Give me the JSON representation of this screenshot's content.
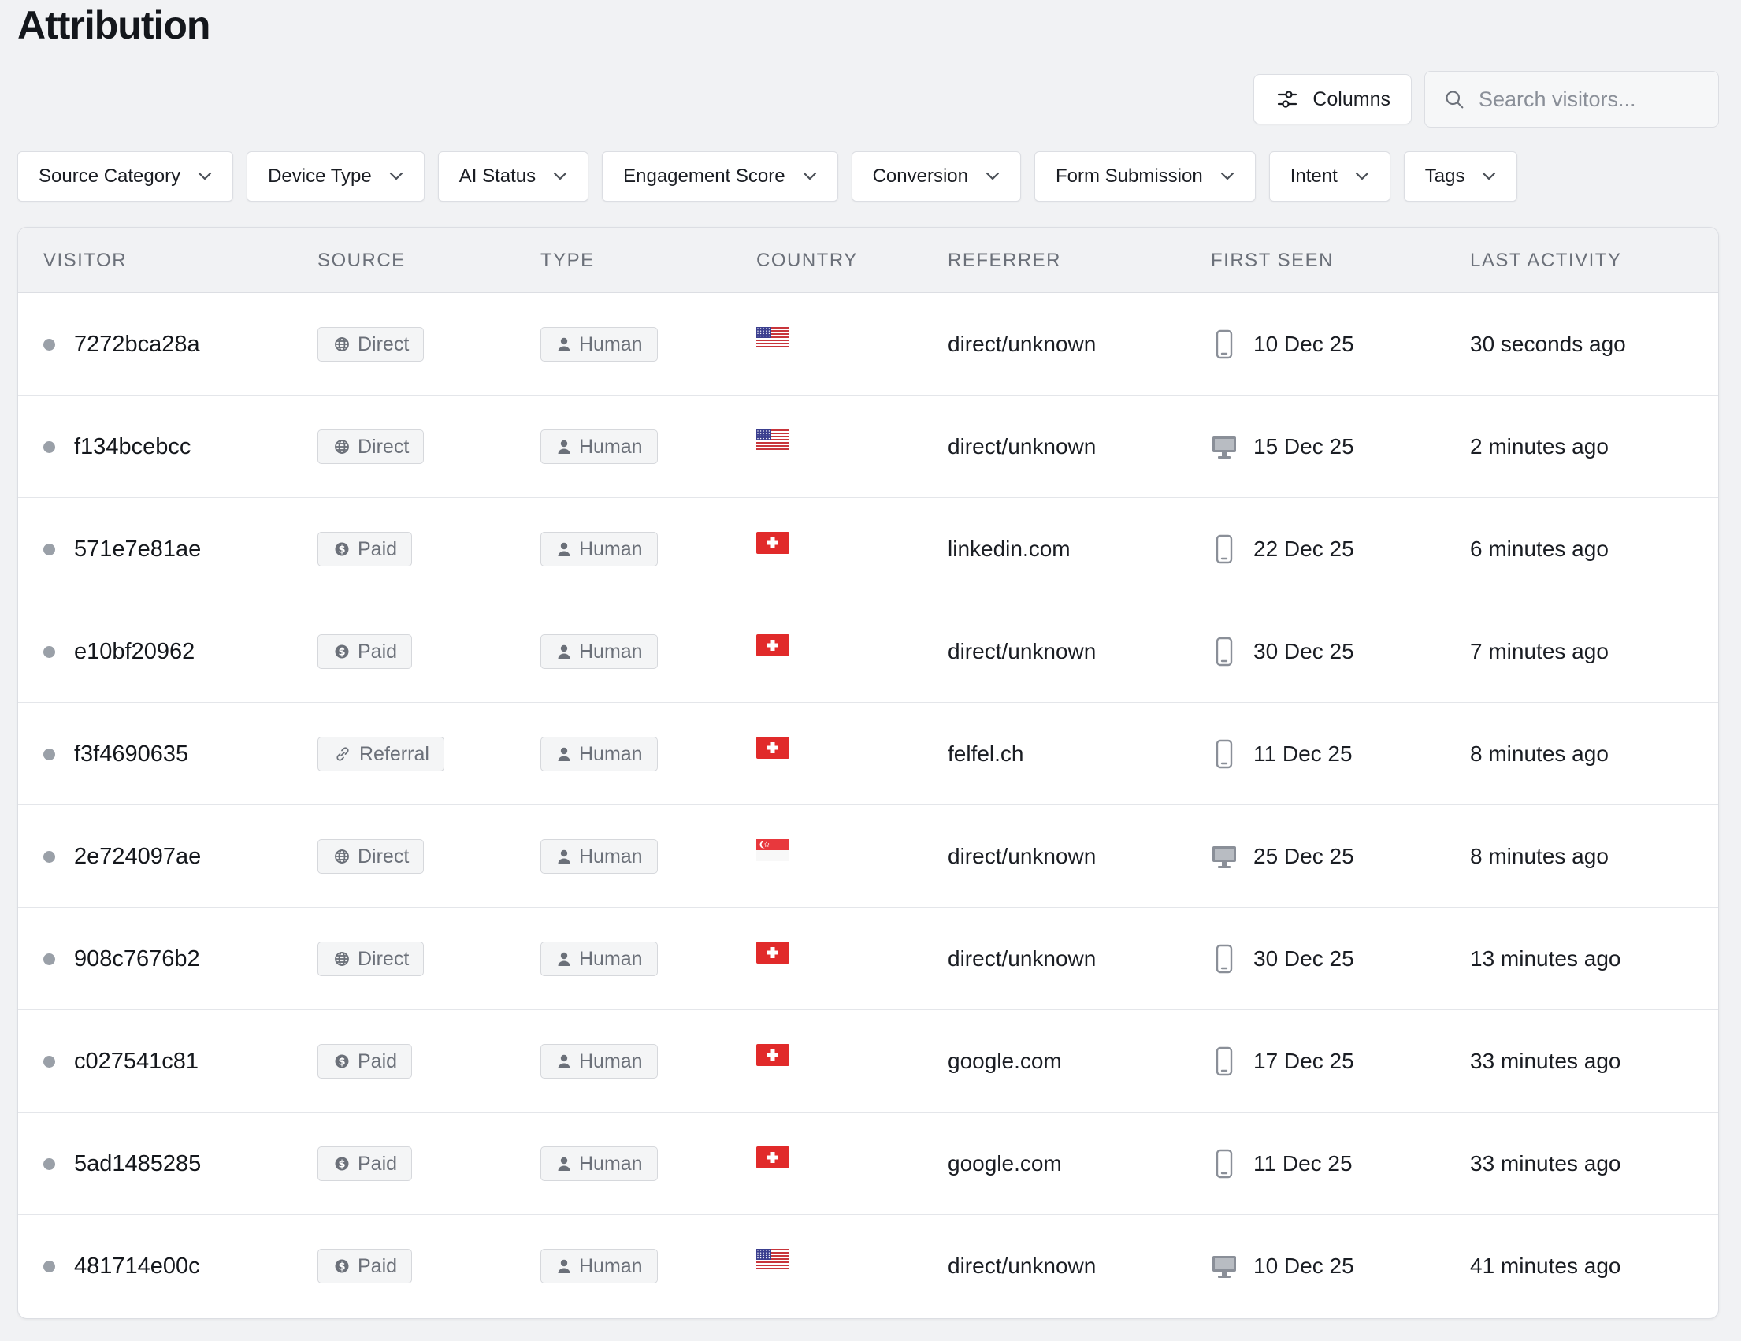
{
  "page": {
    "title": "Attribution"
  },
  "toolbar": {
    "columns_label": "Columns",
    "search_placeholder": "Search visitors..."
  },
  "filters": [
    "Source Category",
    "Device Type",
    "AI Status",
    "Engagement Score",
    "Conversion",
    "Form Submission",
    "Intent",
    "Tags"
  ],
  "table": {
    "headers": [
      "VISITOR",
      "SOURCE",
      "TYPE",
      "COUNTRY",
      "REFERRER",
      "FIRST SEEN",
      "LAST ACTIVITY"
    ],
    "rows": [
      {
        "visitor": "7272bca28a",
        "source": "Direct",
        "source_icon": "globe-icon",
        "type": "Human",
        "country_flag": "us-flag",
        "referrer": "direct/unknown",
        "device": "mobile-icon",
        "first_seen": "10 Dec 25",
        "last_activity": "30 seconds ago"
      },
      {
        "visitor": "f134bcebcc",
        "source": "Direct",
        "source_icon": "globe-icon",
        "type": "Human",
        "country_flag": "us-flag",
        "referrer": "direct/unknown",
        "device": "desktop-icon",
        "first_seen": "15 Dec 25",
        "last_activity": "2 minutes ago"
      },
      {
        "visitor": "571e7e81ae",
        "source": "Paid",
        "source_icon": "dollar-icon",
        "type": "Human",
        "country_flag": "ch-flag",
        "referrer": "linkedin.com",
        "device": "mobile-icon",
        "first_seen": "22 Dec 25",
        "last_activity": "6 minutes ago"
      },
      {
        "visitor": "e10bf20962",
        "source": "Paid",
        "source_icon": "dollar-icon",
        "type": "Human",
        "country_flag": "ch-flag",
        "referrer": "direct/unknown",
        "device": "mobile-icon",
        "first_seen": "30 Dec 25",
        "last_activity": "7 minutes ago"
      },
      {
        "visitor": "f3f4690635",
        "source": "Referral",
        "source_icon": "link-icon",
        "type": "Human",
        "country_flag": "ch-flag",
        "referrer": "felfel.ch",
        "device": "mobile-icon",
        "first_seen": "11 Dec 25",
        "last_activity": "8 minutes ago"
      },
      {
        "visitor": "2e724097ae",
        "source": "Direct",
        "source_icon": "globe-icon",
        "type": "Human",
        "country_flag": "sg-flag",
        "referrer": "direct/unknown",
        "device": "desktop-icon",
        "first_seen": "25 Dec 25",
        "last_activity": "8 minutes ago"
      },
      {
        "visitor": "908c7676b2",
        "source": "Direct",
        "source_icon": "globe-icon",
        "type": "Human",
        "country_flag": "ch-flag",
        "referrer": "direct/unknown",
        "device": "mobile-icon",
        "first_seen": "30 Dec 25",
        "last_activity": "13 minutes ago"
      },
      {
        "visitor": "c027541c81",
        "source": "Paid",
        "source_icon": "dollar-icon",
        "type": "Human",
        "country_flag": "ch-flag",
        "referrer": "google.com",
        "device": "mobile-icon",
        "first_seen": "17 Dec 25",
        "last_activity": "33 minutes ago"
      },
      {
        "visitor": "5ad1485285",
        "source": "Paid",
        "source_icon": "dollar-icon",
        "type": "Human",
        "country_flag": "ch-flag",
        "referrer": "google.com",
        "device": "mobile-icon",
        "first_seen": "11 Dec 25",
        "last_activity": "33 minutes ago"
      },
      {
        "visitor": "481714e00c",
        "source": "Paid",
        "source_icon": "dollar-icon",
        "type": "Human",
        "country_flag": "us-flag",
        "referrer": "direct/unknown",
        "device": "desktop-icon",
        "first_seen": "10 Dec 25",
        "last_activity": "41 minutes ago"
      }
    ]
  },
  "colors": {
    "background": "#f1f2f4",
    "card": "#ffffff",
    "border": "#dcdee3",
    "muted_text": "#6b7079",
    "status_dot": "#9aa0a8",
    "flag_red": "#e12a2a"
  }
}
